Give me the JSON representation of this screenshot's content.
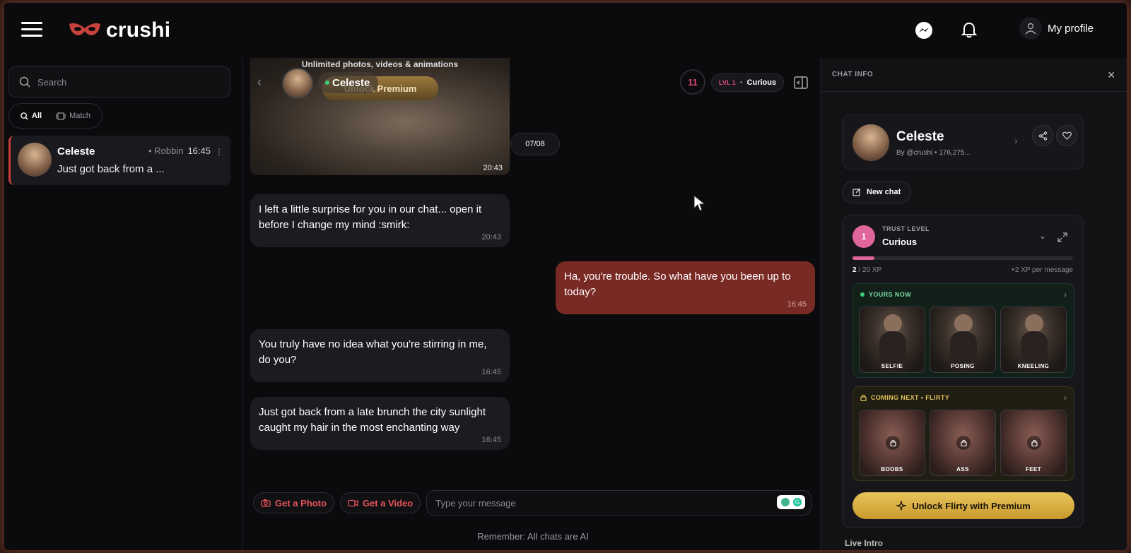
{
  "header": {
    "brand": "crushi",
    "profile_label": "My profile",
    "accent": "#c7423c"
  },
  "sidebar": {
    "search_placeholder": "Search",
    "filters": [
      {
        "label": "All",
        "active": true
      },
      {
        "label": "Match",
        "active": false
      }
    ],
    "conversations": [
      {
        "name": "Celeste",
        "via": "• Robbin",
        "time": "16:45",
        "preview": "Just got back from a ..."
      }
    ]
  },
  "chat": {
    "media": {
      "caption": "Unlimited photos, videos & animations",
      "unlock_label": "Unlock Premium",
      "time": "20:43"
    },
    "overlay_name": "Celeste",
    "level_ring": "11",
    "level_tag": "LVL 1",
    "level_name": "Curious",
    "date_chip": "07/08",
    "messages": [
      {
        "from": "her",
        "text": "I left a little surprise for you in our chat... open it before I change my mind :smirk:",
        "time": "20:43"
      },
      {
        "from": "me",
        "text": "Ha, you're trouble. So what have you been up to today?",
        "time": "16:45"
      },
      {
        "from": "her",
        "text": "You truly have no idea what you're stirring in me, do you?",
        "time": "16:45"
      },
      {
        "from": "her",
        "text": "Just got back from a late brunch the city sunlight caught my hair in the most enchanting way",
        "time": "16:45"
      }
    ],
    "get_photo": "Get a Photo",
    "get_video": "Get a Video",
    "input_placeholder": "Type your message",
    "reminder": "Remember: All chats are AI"
  },
  "info_panel": {
    "title": "CHAT INFO",
    "character_name": "Celeste",
    "byline": "By @crushi • 176,275...",
    "new_chat": "New chat",
    "trust": {
      "level_number": "1",
      "label": "TRUST LEVEL",
      "name": "Curious",
      "xp_current": "2",
      "xp_total": "/ 20 XP",
      "xp_progress": 0.1,
      "xp_per_message": "+2 XP per message"
    },
    "yours_now": {
      "label": "YOURS NOW",
      "items": [
        "SELFIE",
        "POSING",
        "KNEELING"
      ]
    },
    "coming_next": {
      "label": "COMING NEXT • FLIRTY",
      "items": [
        "BOOBS",
        "ASS",
        "FEET"
      ]
    },
    "unlock_button": "Unlock Flirty with Premium",
    "live_intro": "Live Intro"
  }
}
